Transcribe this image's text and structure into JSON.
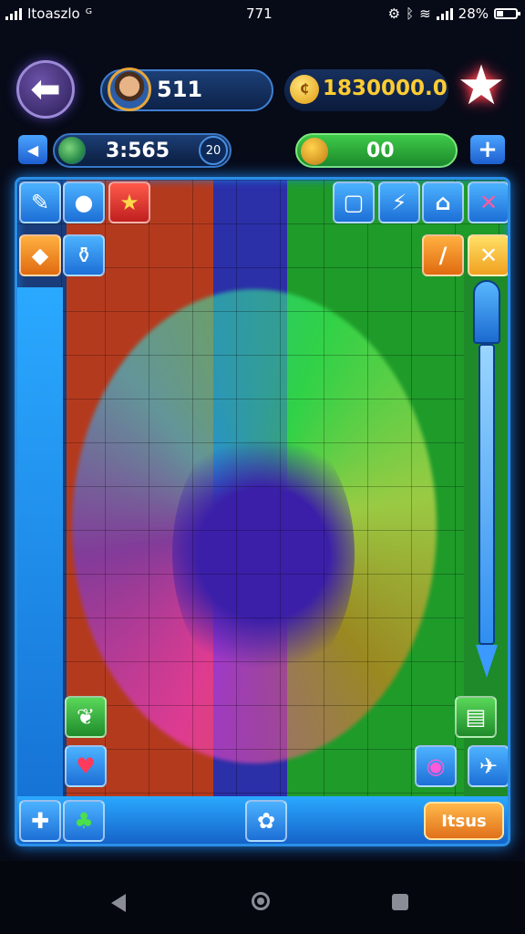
{
  "status_bar": {
    "carrier": "Itoaszlo",
    "time": "771",
    "battery": "28%"
  },
  "hud": {
    "player_value": "511",
    "coins": "1830000.0",
    "coin_icon_label": "₵",
    "timer": "3:565",
    "level": "20",
    "score": "00"
  },
  "board": {
    "tiles": [
      {
        "icon": "brush-icon",
        "glyph": "✎"
      },
      {
        "icon": "speech-bubble-icon",
        "glyph": "●"
      },
      {
        "icon": "star-icon",
        "glyph": "★"
      },
      {
        "icon": "square-icon",
        "glyph": "▢"
      },
      {
        "icon": "lightning-icon",
        "glyph": "⚡"
      },
      {
        "icon": "house-icon",
        "glyph": "⌂"
      },
      {
        "icon": "cross-swords-icon",
        "glyph": "✕"
      },
      {
        "icon": "candy-icon",
        "glyph": "◆"
      },
      {
        "icon": "potion-icon",
        "glyph": "⚱"
      },
      {
        "icon": "wand-icon",
        "glyph": "∕"
      },
      {
        "icon": "x-tile-icon",
        "glyph": "✕"
      },
      {
        "icon": "leaf-icon",
        "glyph": "❦"
      },
      {
        "icon": "heart-icon",
        "glyph": "♥"
      },
      {
        "icon": "ticket-icon",
        "glyph": "▤"
      },
      {
        "icon": "gem-icon",
        "glyph": "◉"
      },
      {
        "icon": "rocket-icon",
        "glyph": "✈"
      },
      {
        "icon": "tag-icon",
        "glyph": "✚"
      },
      {
        "icon": "frog-icon",
        "glyph": "♣"
      },
      {
        "icon": "puzzle-piece-icon",
        "glyph": "✿"
      }
    ],
    "tasks_button": "Itsus"
  }
}
